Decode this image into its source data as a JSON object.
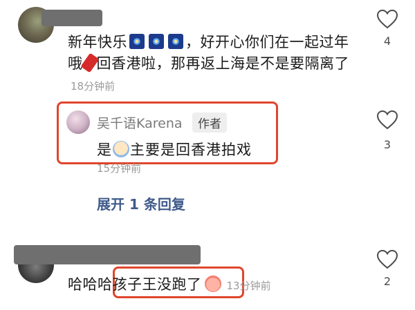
{
  "comments": [
    {
      "text_part1": "新年快乐",
      "text_part2": "，好开心你们在一起过年哦",
      "text_part3": "回香港啦，那再返上海是不是要隔离了",
      "time": "18分钟前",
      "likes": "4",
      "emojis": [
        "fireworks",
        "fireworks",
        "fireworks",
        "firecracker"
      ]
    },
    {
      "text_part1": "哈哈哈",
      "text_highlight": "孩子王没跑了",
      "time": "13分钟前",
      "likes": "2",
      "emojis": [
        "peach-face"
      ]
    }
  ],
  "reply": {
    "author": "吴千语Karena",
    "badge": "作者",
    "text_part1": "是",
    "text_part2": "主要是回香港拍戏",
    "time": "15分钟前",
    "likes": "3",
    "emojis": [
      "crying-face"
    ]
  },
  "expand_label": "展开 1 条回复",
  "colors": {
    "highlight_box": "#e0452c",
    "link": "#3f5a8a",
    "timestamp": "#9a9a9a",
    "redaction": "#6f6f6f"
  }
}
